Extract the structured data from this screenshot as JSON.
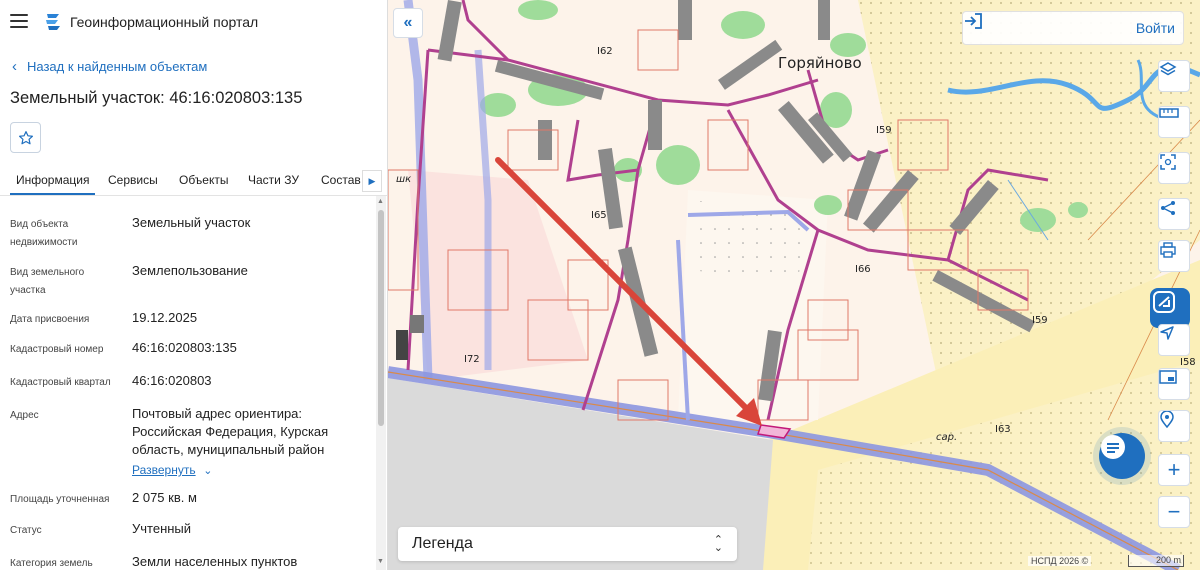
{
  "header": {
    "menu_icon": "hamburger-icon",
    "logo_icon": "portal-logo-icon",
    "title": "Геоинформационный портал"
  },
  "nav": {
    "back_label": "Назад к найденным объектам"
  },
  "object": {
    "title": "Земельный участок: 46:16:020803:135",
    "favorite_icon": "star-icon"
  },
  "tabs": [
    {
      "label": "Информация",
      "active": true
    },
    {
      "label": "Сервисы"
    },
    {
      "label": "Объекты"
    },
    {
      "label": "Части ЗУ"
    },
    {
      "label": "Состав"
    }
  ],
  "attributes": [
    {
      "label": "Вид объекта недвижимости",
      "value": "Земельный участок"
    },
    {
      "label": "Вид земельного участка",
      "value": "Землепользование"
    },
    {
      "label": "Дата присвоения",
      "value": "19.12.2025"
    },
    {
      "label": "Кадастровый номер",
      "value": "46:16:020803:135"
    },
    {
      "label": "Кадастровый квартал",
      "value": "46:16:020803"
    },
    {
      "label": "Адрес",
      "value": "Почтовый адрес ориентира: Российская Федерация, Курская область, муниципальный район",
      "expand_label": "Развернуть"
    },
    {
      "label": "Площадь уточненная",
      "value": "2 075 кв. м"
    },
    {
      "label": "Статус",
      "value": "Учтенный"
    },
    {
      "label": "Категория земель",
      "value": "Земли населенных пунктов"
    }
  ],
  "map": {
    "login_label": "Войти",
    "legend_label": "Легенда",
    "attribution": "НСПД 2026 ©",
    "scale_label": "200 m",
    "labels": {
      "village": "Горяйново",
      "h162": "I62",
      "h159a": "I59",
      "h165": "I65",
      "h166": "I66",
      "h159b": "I59",
      "h172": "I72",
      "h163": "I63",
      "h158": "I58",
      "sar": "сар.",
      "shk": "шк"
    },
    "tools": [
      "layers-icon",
      "ruler-icon",
      "select-area-icon",
      "share-icon",
      "print-icon",
      "nspd-logo-icon",
      "locate-icon",
      "minimap-icon",
      "geo-pin-icon",
      "zoom-in-icon",
      "zoom-out-icon"
    ]
  }
}
